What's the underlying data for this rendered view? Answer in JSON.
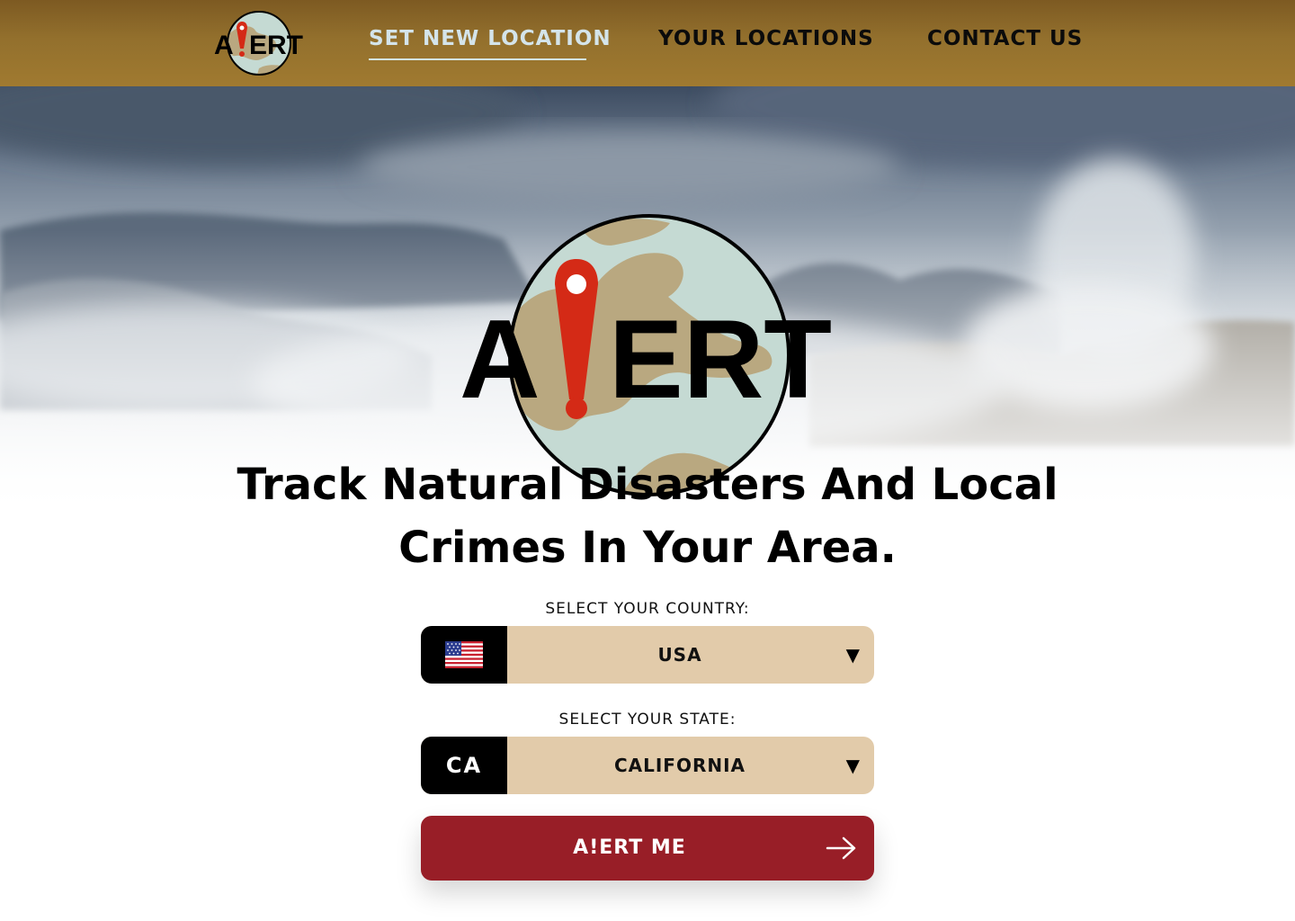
{
  "header": {
    "logo_text": "A!ERT",
    "nav": [
      {
        "label": "SET NEW LOCATION",
        "active": true
      },
      {
        "label": "YOUR LOCATIONS",
        "active": false
      },
      {
        "label": "CONTACT US",
        "active": false
      }
    ]
  },
  "hero": {
    "logo_text": "A!ERT",
    "headline_line1": "Track Natural Disasters And Local",
    "headline_line2": "Crimes In Your Area."
  },
  "form": {
    "country": {
      "label": "SELECT YOUR COUNTRY:",
      "prefix_icon": "us-flag-icon",
      "value": "USA"
    },
    "state": {
      "label": "SELECT YOUR STATE:",
      "prefix": "CA",
      "value": "CALIFORNIA"
    },
    "dropdown_glyph": "▼",
    "submit_label": "A!ERT ME"
  },
  "colors": {
    "header": "#93702d",
    "nav_active": "#d4e4ea",
    "select_bg": "#e2cbaa",
    "prefix_bg": "#000000",
    "button": "#981e27",
    "pin_red": "#d42a16",
    "globe_water": "#c5dad3",
    "globe_land": "#b9a880"
  }
}
